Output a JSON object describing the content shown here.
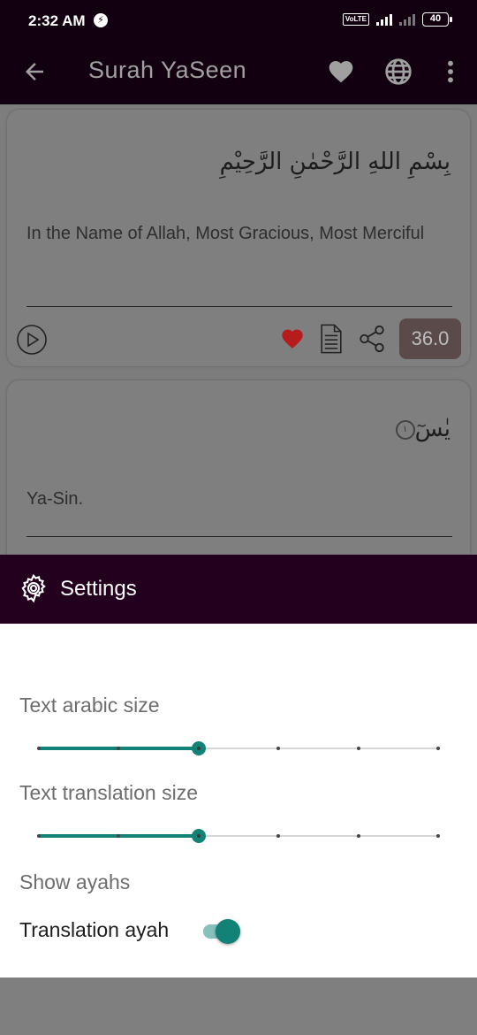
{
  "status_bar": {
    "time": "2:32 AM",
    "volte": "Vo LTE",
    "battery": "40"
  },
  "app_bar": {
    "title": "Surah YaSeen",
    "icons": [
      "back-arrow-icon",
      "heart-icon",
      "globe-icon",
      "more-vert-icon"
    ]
  },
  "verses": [
    {
      "arabic": "بِسْمِ اللهِ الرَّحْمٰنِ الرَّحِيْمِ",
      "translation": "In the Name of Allah, Most Gracious, Most Merciful",
      "size_badge": "36.0"
    },
    {
      "arabic": "يٰسٓ",
      "ayah_number": "١",
      "translation": "Ya-Sin."
    }
  ],
  "settings": {
    "title": "Settings",
    "arabic_size_label": "Text arabic size",
    "arabic_size_step": 2,
    "translation_size_label": "Text translation size",
    "translation_size_step": 2,
    "slider_steps": 6,
    "show_ayahs_label": "Show ayahs",
    "translation_ayah_label": "Translation ayah",
    "translation_ayah_on": true
  },
  "colors": {
    "accent": "#118275",
    "header": "#22001e",
    "appbar": "#120010",
    "heart": "#c62828"
  }
}
